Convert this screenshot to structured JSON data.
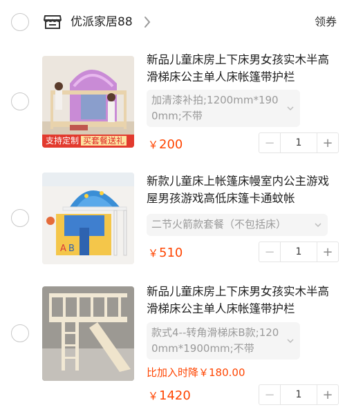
{
  "shop": {
    "name": "优派家居88",
    "coupon_label": "领券",
    "store_icon": "store-icon",
    "chevron_icon": "chevron-right-icon"
  },
  "items": [
    {
      "title": "新品儿童床房上下床男女孩实木半高滑梯床公主单人床帐篷带护栏",
      "variant": "加清漆补拍;1200mm*1900mm;不带",
      "price_symbol": "￥",
      "price": "200",
      "quantity": "1",
      "promo": {
        "label": "支持定制",
        "highlight": "买套餐送礼"
      }
    },
    {
      "title": "新款儿童床上帐篷床幔室内公主游戏屋男孩游戏高低床篷卡通蚊帐",
      "variant": "二节火箭款套餐（不包括床）",
      "price_symbol": "￥",
      "price": "510",
      "quantity": "1"
    },
    {
      "title": "新品儿童床房上下床男女孩实木半高滑梯床公主单人床帐篷带护栏",
      "variant": "款式4--转角滑梯床B款;1200mm*1900mm;不带",
      "price_drop_note": "比加入时降￥180.00",
      "price_symbol": "￥",
      "price": "1420",
      "quantity": "1"
    }
  ],
  "colors": {
    "accent": "#ff4400",
    "promo_red": "#e23a2e",
    "variant_bg": "#f5f5f5",
    "radio_border": "#c8c8c8"
  },
  "icons": {
    "minus": "−",
    "plus": "+"
  }
}
